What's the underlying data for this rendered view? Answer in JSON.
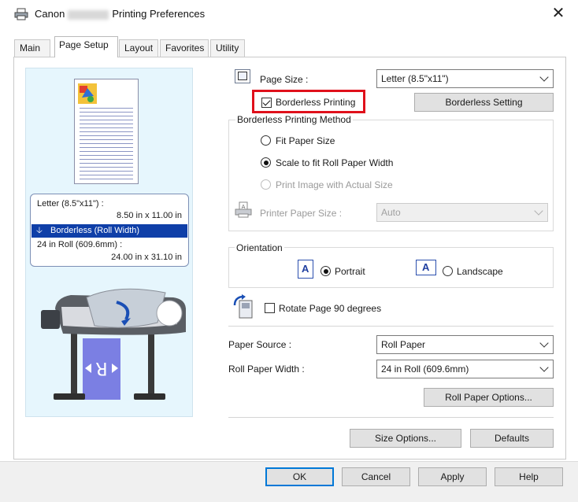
{
  "window": {
    "title_prefix": "Canon",
    "title_suffix": "Printing Preferences",
    "close_glyph": "✕"
  },
  "tabs": [
    {
      "label": "Main"
    },
    {
      "label": "Page Setup"
    },
    {
      "label": "Layout"
    },
    {
      "label": "Favorites"
    },
    {
      "label": "Utility"
    }
  ],
  "preview": {
    "line1": "Letter (8.5\"x11\") :",
    "line2": "8.50 in x 11.00 in",
    "selected_label": "Borderless (Roll Width)",
    "line4": "24 in Roll (609.6mm) :",
    "line5": "24.00 in x 31.10 in",
    "arrow_glyph": "🡣"
  },
  "page_size": {
    "label": "Page Size :",
    "value": "Letter (8.5\"x11\")"
  },
  "borderless": {
    "checkbox_label": "Borderless Printing",
    "checked": true,
    "settings_button": "Borderless Setting",
    "method_legend": "Borderless Printing Method",
    "options": [
      {
        "label": "Fit Paper Size",
        "checked": false,
        "enabled": true
      },
      {
        "label": "Scale to fit Roll Paper Width",
        "checked": true,
        "enabled": true
      },
      {
        "label": "Print Image with Actual Size",
        "checked": false,
        "enabled": false
      }
    ],
    "printer_paper_size_label": "Printer Paper Size :",
    "printer_paper_size_value": "Auto"
  },
  "orientation": {
    "legend": "Orientation",
    "portrait": "Portrait",
    "landscape": "Landscape",
    "selected": "Portrait",
    "icon_letter": "A"
  },
  "rotate": {
    "label": "Rotate Page 90 degrees",
    "checked": false
  },
  "paper_source": {
    "label": "Paper Source :",
    "value": "Roll Paper"
  },
  "roll_width": {
    "label": "Roll Paper Width :",
    "value": "24 in Roll (609.6mm)"
  },
  "buttons": {
    "roll_paper_options": "Roll Paper Options...",
    "size_options": "Size Options...",
    "defaults": "Defaults",
    "ok": "OK",
    "cancel": "Cancel",
    "apply": "Apply",
    "help": "Help"
  },
  "colors": {
    "highlight": "#e0101b",
    "selection": "#0f3fa8",
    "preview_bg": "#e6f6fd",
    "focus_border": "#0078d7"
  }
}
